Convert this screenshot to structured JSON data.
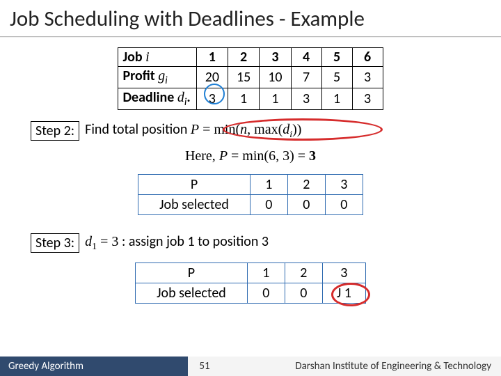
{
  "title": "Job Scheduling with Deadlines - Example",
  "data_table": {
    "row_labels": {
      "job": "Job ",
      "profit": "Profit ",
      "deadline": "Deadline "
    },
    "row_symbols": {
      "job": "i",
      "profit": "g",
      "profit_sub": "i",
      "deadline": "d",
      "deadline_sub": "i",
      "deadline_end": "."
    },
    "cols": [
      "1",
      "2",
      "3",
      "4",
      "5",
      "6"
    ],
    "profit": [
      "20",
      "15",
      "10",
      "7",
      "5",
      "3"
    ],
    "deadline": [
      "3",
      "1",
      "1",
      "3",
      "1",
      "3"
    ]
  },
  "step2": {
    "label": "Step 2:",
    "text_a": "Find total position ",
    "eq_lhs": "P",
    "eq_eqs": " = min(",
    "eq_n": "n",
    "eq_mid": ", max(",
    "eq_di": "d",
    "eq_di_sub": "i",
    "eq_end": "))"
  },
  "here": {
    "pre": "Here, ",
    "lhs": "P",
    "eq": " = min(6, 3) = ",
    "ans": "3"
  },
  "p_table_before": {
    "h1": "P",
    "h2": "1",
    "h3": "2",
    "h4": "3",
    "r1": "Job selected",
    "v1": "0",
    "v2": "0",
    "v3": "0"
  },
  "step3": {
    "label": "Step 3:",
    "d": "d",
    "dsub": "1",
    "eq": " = 3",
    "txt": " : assign job 1 to position 3"
  },
  "p_table_after": {
    "h1": "P",
    "h2": "1",
    "h3": "2",
    "h4": "3",
    "r1": "Job selected",
    "v1": "0",
    "v2": "0",
    "v3": "J 1"
  },
  "footer": {
    "left": "Greedy Algorithm",
    "page": "51",
    "right": "Darshan Institute of Engineering & Technology"
  },
  "chart_data": {
    "type": "table",
    "title": "Job Scheduling with Deadlines - Example",
    "columns": [
      "Job i",
      "1",
      "2",
      "3",
      "4",
      "5",
      "6"
    ],
    "rows": [
      {
        "label": "Profit g_i",
        "values": [
          20,
          15,
          10,
          7,
          5,
          3
        ]
      },
      {
        "label": "Deadline d_i",
        "values": [
          3,
          1,
          1,
          3,
          1,
          3
        ]
      }
    ],
    "derived": {
      "P": 3,
      "n": 6,
      "max_d": 3
    },
    "schedule_before": {
      "positions": [
        1,
        2,
        3
      ],
      "jobs": [
        0,
        0,
        0
      ]
    },
    "step3_assignment": {
      "job": 1,
      "position": 3
    },
    "schedule_after": {
      "positions": [
        1,
        2,
        3
      ],
      "jobs": [
        0,
        0,
        "J1"
      ]
    }
  }
}
